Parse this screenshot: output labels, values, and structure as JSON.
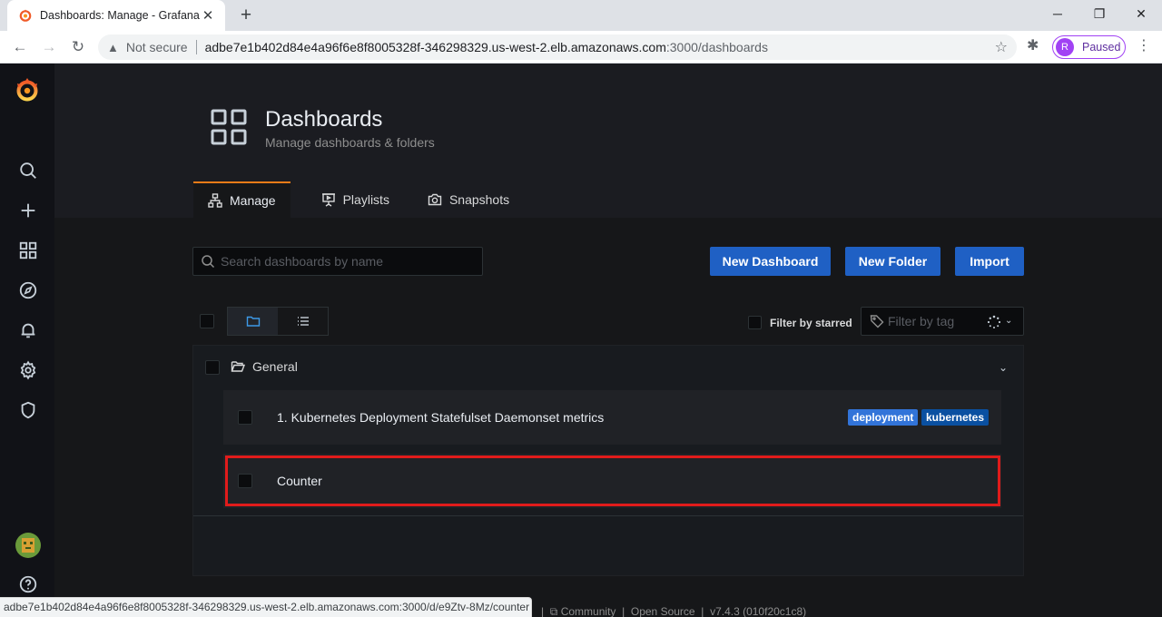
{
  "browser": {
    "tab_title": "Dashboards: Manage - Grafana",
    "security_label": "Not secure",
    "url_host": "adbe7e1b402d84e4a96f6e8f8005328f-346298329.us-west-2.elb.amazonaws.com",
    "url_path": ":3000/dashboards",
    "profile_initial": "R",
    "profile_status": "Paused",
    "status_url": "adbe7e1b402d84e4a96f6e8f8005328f-346298329.us-west-2.elb.amazonaws.com:3000/d/e9Ztv-8Mz/counter"
  },
  "page": {
    "title": "Dashboards",
    "subtitle": "Manage dashboards & folders"
  },
  "tabs": [
    {
      "label": "Manage",
      "icon": "sitemap-icon",
      "active": true
    },
    {
      "label": "Playlists",
      "icon": "presentation-icon"
    },
    {
      "label": "Snapshots",
      "icon": "camera-icon"
    }
  ],
  "search": {
    "placeholder": "Search dashboards by name"
  },
  "actions": {
    "new_dashboard": "New Dashboard",
    "new_folder": "New Folder",
    "import": "Import"
  },
  "filters": {
    "starred_label": "Filter by starred",
    "tag_placeholder": "Filter by tag"
  },
  "folder": {
    "name": "General",
    "items": [
      {
        "title": "1. Kubernetes Deployment Statefulset Daemonset metrics",
        "tags": [
          "deployment",
          "kubernetes"
        ]
      },
      {
        "title": "Counter",
        "tags": []
      }
    ]
  },
  "footer": {
    "community": "Community",
    "open_source": "Open Source",
    "version": "v7.4.3 (010f20c1c8)"
  },
  "colors": {
    "primary_button": "#1f60c4",
    "active_tab_border": "#eb7b18",
    "tag_deployment": "#3274d9",
    "tag_kubernetes": "#0a50a1",
    "highlight_box": "#e01b1b"
  }
}
